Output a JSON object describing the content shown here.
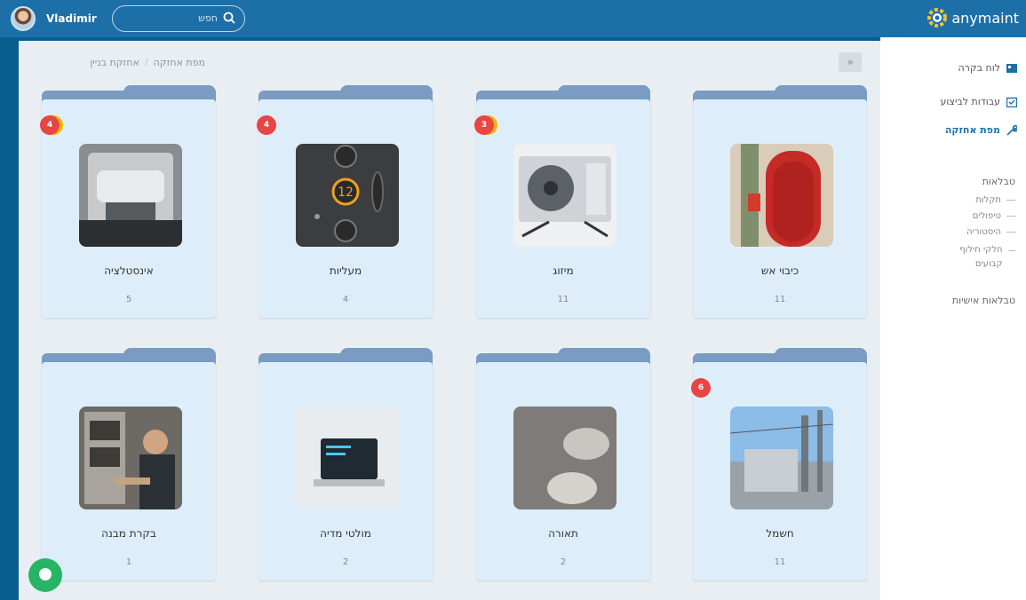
{
  "header": {
    "username": "Vladimir",
    "search": {
      "placeholder": "חפש"
    },
    "logo_text": "anymaint"
  },
  "breadcrumb": {
    "items": [
      "מפת אחזקה",
      "אחזקת בניין"
    ]
  },
  "collapse_label": "»",
  "cards": [
    {
      "title": "כיבוי אש",
      "count": "11",
      "badge": "",
      "image": "fire-door-icon"
    },
    {
      "title": "מיזוג",
      "count": "11",
      "badge": "3",
      "image": "ac-unit-icon"
    },
    {
      "title": "מעליות",
      "count": "4",
      "badge": "4",
      "image": "elevator-buttons-icon"
    },
    {
      "title": "אינסטלציה",
      "count": "5",
      "badge": "4",
      "image": "plumbing-icon"
    },
    {
      "title": "חשמל",
      "count": "11",
      "badge": "6",
      "image": "electric-station-icon"
    },
    {
      "title": "תאורה",
      "count": "2",
      "badge": "",
      "image": "ceiling-lights-icon"
    },
    {
      "title": "מולטי מדיה",
      "count": "2",
      "badge": "",
      "image": "laptop-media-icon"
    },
    {
      "title": "בקרת מבנה",
      "count": "1",
      "badge": "",
      "image": "building-control-icon"
    }
  ],
  "sidebar": {
    "nav": [
      {
        "label": "לוח בקרה",
        "icon": "dashboard-icon"
      },
      {
        "label": "עבודות לביצוע",
        "icon": "tasks-icon"
      },
      {
        "label": "מפת אחזקה",
        "icon": "wrench-icon",
        "active": true
      }
    ],
    "tables_header": "טבלאות",
    "tables": [
      "תקלות",
      "טיפולים",
      "היסטוריה",
      "חלקי חילוף קבועים"
    ],
    "my_tables": "טבלאות אישיות"
  },
  "colors": {
    "topbar": "#1d6fa8",
    "badge": "#e84545",
    "card": "#ddeefa",
    "folder": "#7a9cc3",
    "chat": "#27b565"
  }
}
